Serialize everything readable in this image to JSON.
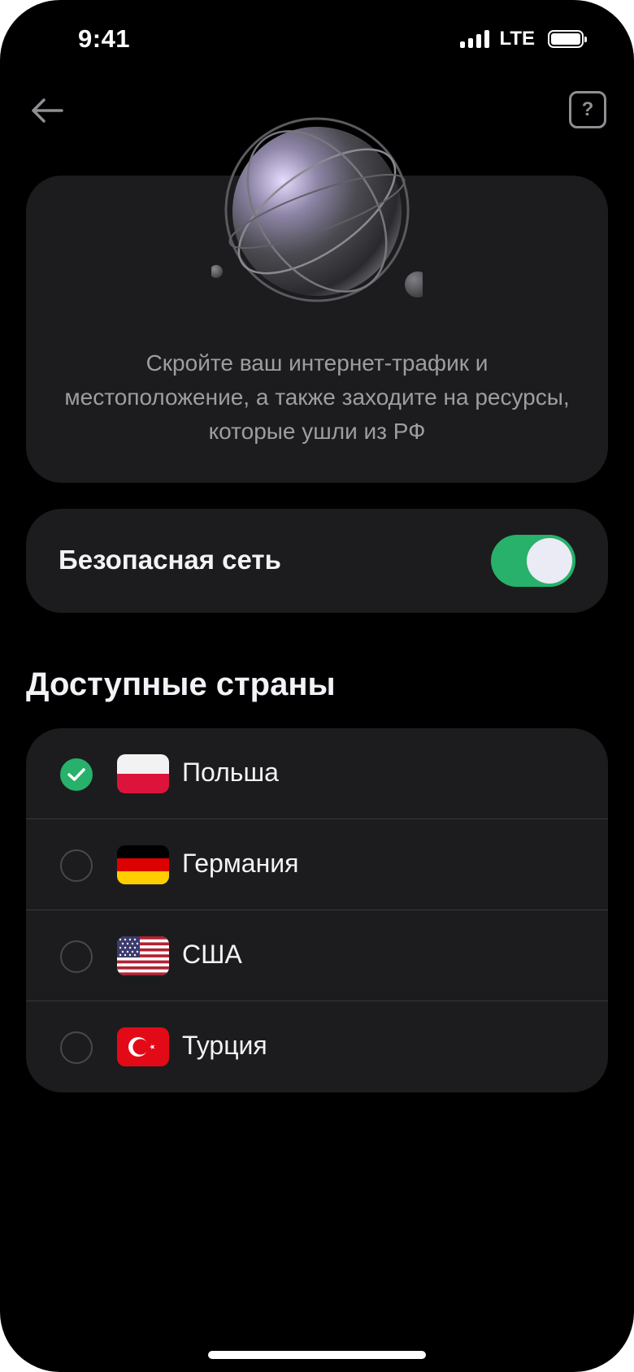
{
  "status_bar": {
    "time": "9:41",
    "network": "LTE"
  },
  "header": {
    "back_icon": "arrow-left-icon",
    "help_label": "?"
  },
  "hero": {
    "illustration": "globe-icon",
    "description": "Скройте ваш интернет-трафик и местоположение, а также заходите на ресурсы, которые ушли из РФ"
  },
  "secure_network": {
    "label": "Безопасная сеть",
    "enabled": true
  },
  "countries": {
    "title": "Доступные страны",
    "items": [
      {
        "label": "Польша",
        "flag": "poland-flag",
        "selected": true
      },
      {
        "label": "Германия",
        "flag": "germany-flag",
        "selected": false
      },
      {
        "label": "США",
        "flag": "usa-flag",
        "selected": false
      },
      {
        "label": "Турция",
        "flag": "turkey-flag",
        "selected": false
      }
    ]
  },
  "colors": {
    "accent": "#27b16b",
    "card": "#1c1c1e",
    "background": "#000000",
    "muted_text": "#9d9da3"
  }
}
